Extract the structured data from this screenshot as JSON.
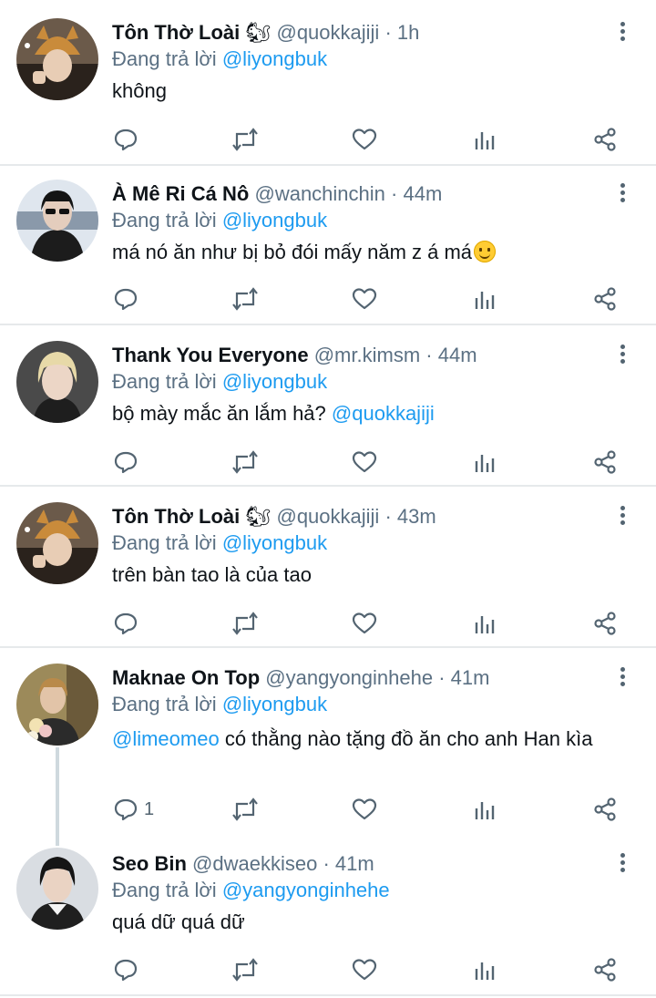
{
  "tweets": [
    {
      "name": "Tôn Thờ Loài",
      "name_emoji": "🐿",
      "handle": "@quokkajiji",
      "time": "· 1h",
      "replying_prefix": "Đang trả lời",
      "replying_to": "@liyongbuk",
      "body_text": "không",
      "reply_count": "",
      "avatar_icon": "avatar-cat-beanie"
    },
    {
      "name": "À Mê Ri Cá Nô",
      "handle": "@wanchinchin",
      "time": "· 44m",
      "replying_prefix": "Đang trả lời",
      "replying_to": "@liyongbuk",
      "body_text": "má nó ăn như bị bỏ đói mấy năm z á má",
      "reply_count": "",
      "avatar_icon": "avatar-sunglasses"
    },
    {
      "name": "Thank You Everyone",
      "handle": "@mr.kimsm",
      "time": "· 44m",
      "replying_prefix": "Đang trả lời",
      "replying_to": "@liyongbuk",
      "body_text": "bộ mày mắc ăn lắm hả?",
      "body_mention": "@quokkajiji",
      "reply_count": "",
      "avatar_icon": "avatar-blond"
    },
    {
      "name": "Tôn Thờ Loài",
      "name_emoji": "🐿",
      "handle": "@quokkajiji",
      "time": "· 43m",
      "replying_prefix": "Đang trả lời",
      "replying_to": "@liyongbuk",
      "body_text": "trên bàn tao là của tao",
      "reply_count": "",
      "avatar_icon": "avatar-cat-beanie"
    },
    {
      "name": "Maknae On Top",
      "handle": "@yangyonginhehe",
      "time": "· 41m",
      "replying_prefix": "Đang trả lời",
      "replying_to": "@liyongbuk",
      "body_mention_lead": "@limeomeo",
      "body_text": "có thằng nào tặng đồ ăn cho anh Han kìa",
      "reply_count": "1",
      "avatar_icon": "avatar-flowers"
    },
    {
      "name": "Seo Bin",
      "handle": "@dwaekkiseo",
      "time": "· 41m",
      "replying_prefix": "Đang trả lời",
      "replying_to": "@yangyonginhehe",
      "body_text": "quá dữ quá dữ",
      "reply_count": "",
      "avatar_icon": "avatar-dark-hair"
    }
  ],
  "icons": {
    "reply": "reply-icon",
    "retweet": "retweet-icon",
    "like": "heart-icon",
    "analytics": "analytics-icon",
    "share": "share-icon",
    "more": "more-vertical-icon"
  },
  "colors": {
    "link": "#1d9bf0",
    "meta": "#5b7083",
    "divider": "#e6e9eb"
  }
}
